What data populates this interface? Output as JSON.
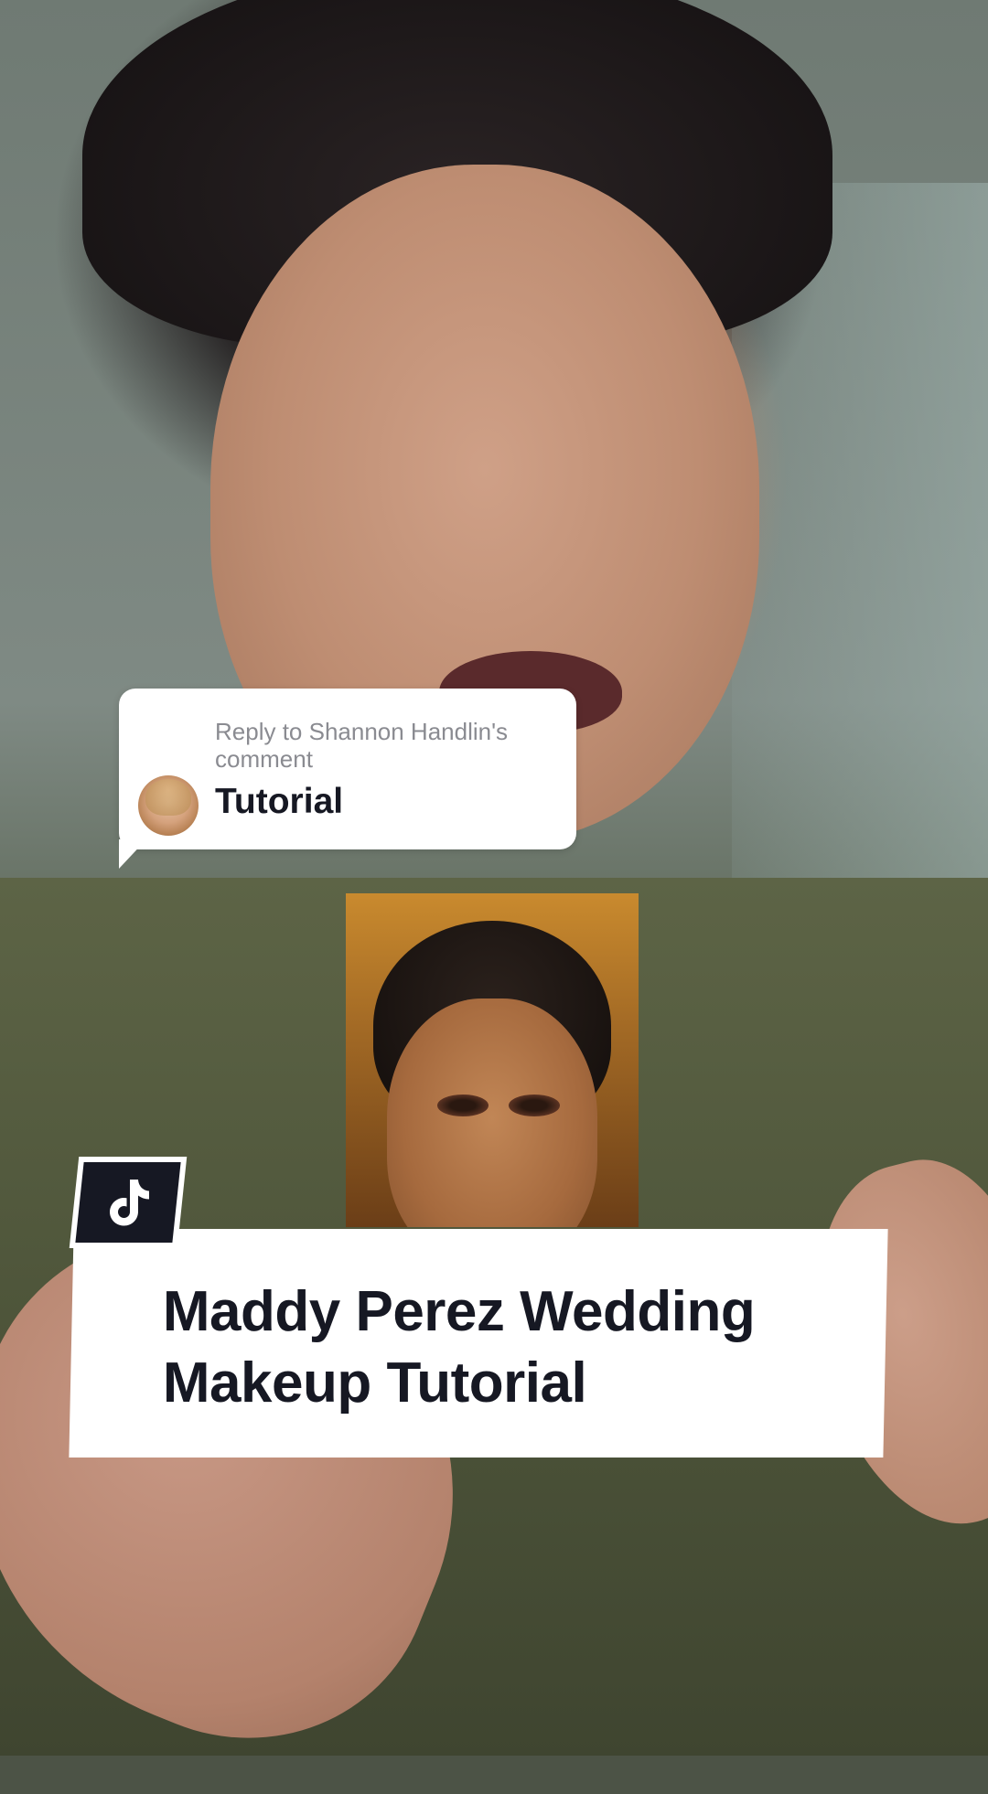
{
  "reply": {
    "header": "Reply to Shannon Handlin's comment",
    "text": "Tutorial"
  },
  "title_card": {
    "line1": "Maddy Perez Wedding",
    "line2": "Makeup Tutorial"
  },
  "colors": {
    "title_text": "#161823",
    "reply_header": "#8a8b91",
    "card_bg": "#ffffff"
  },
  "icons": {
    "badge": "tiktok-logo-icon"
  }
}
